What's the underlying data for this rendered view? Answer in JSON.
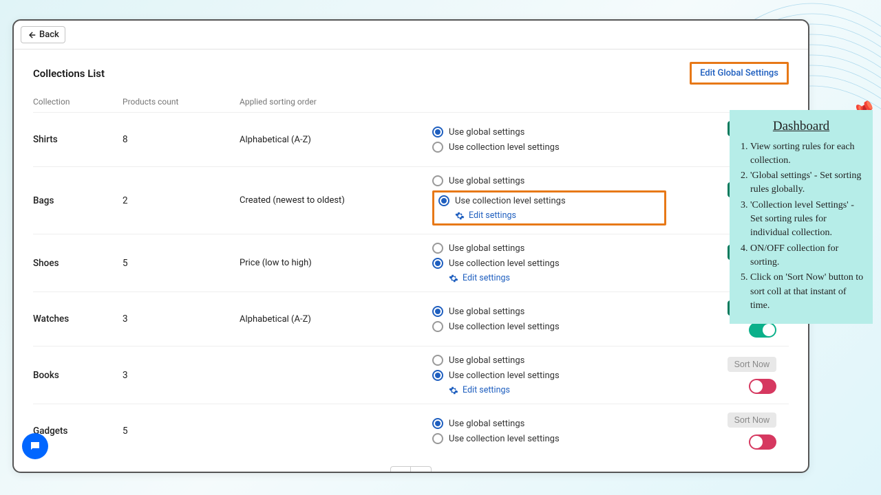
{
  "topbar": {
    "back_label": "Back"
  },
  "header": {
    "title": "Collections List",
    "edit_global": "Edit Global Settings"
  },
  "columns": {
    "name": "Collection",
    "count": "Products count",
    "sort": "Applied sorting order"
  },
  "radio_labels": {
    "global": "Use global settings",
    "collection": "Use collection level settings",
    "edit": "Edit settings"
  },
  "buttons": {
    "sort_now": "Sort Now"
  },
  "rows": [
    {
      "name": "Shirts",
      "count": "8",
      "sort": "Alphabetical (A-Z)",
      "selected": "global",
      "show_edit": false,
      "toggle": "on",
      "sort_enabled": true,
      "highlight": false
    },
    {
      "name": "Bags",
      "count": "2",
      "sort": "Created (newest to oldest)",
      "selected": "collection",
      "show_edit": true,
      "toggle": "on",
      "sort_enabled": true,
      "highlight": true
    },
    {
      "name": "Shoes",
      "count": "5",
      "sort": "Price (low to high)",
      "selected": "collection",
      "show_edit": true,
      "toggle": "on",
      "sort_enabled": true,
      "highlight": false
    },
    {
      "name": "Watches",
      "count": "3",
      "sort": "Alphabetical (A-Z)",
      "selected": "global",
      "show_edit": false,
      "toggle": "on",
      "sort_enabled": true,
      "highlight": false
    },
    {
      "name": "Books",
      "count": "3",
      "sort": "",
      "selected": "collection",
      "show_edit": true,
      "toggle": "off",
      "sort_enabled": false,
      "highlight": false
    },
    {
      "name": "Gadgets",
      "count": "5",
      "sort": "",
      "selected": "global",
      "show_edit": false,
      "toggle": "off",
      "sort_enabled": false,
      "highlight": false
    }
  ],
  "annotation": {
    "title": "Dashboard",
    "items": [
      "View sorting rules for each collection.",
      "'Global settings' - Set sorting rules globally.",
      "'Collection level Settings' - Set sorting rules for individual collection.",
      "ON/OFF collection for sorting.",
      "Click on 'Sort Now' button to sort coll at that instant of time."
    ]
  },
  "colors": {
    "accent": "#1f5fbf",
    "highlight": "#e77817",
    "toggle_on": "#0bb08a",
    "toggle_off": "#d63860",
    "sort_btn": "#0b7a5c"
  }
}
